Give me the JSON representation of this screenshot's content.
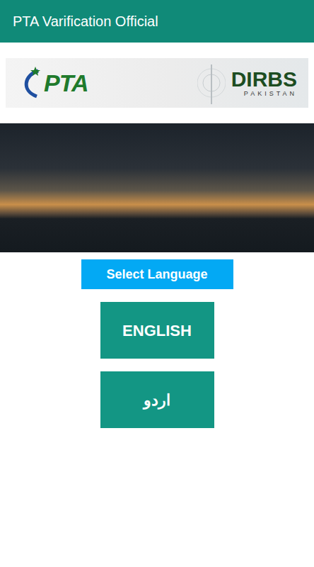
{
  "app_bar": {
    "title": "PTA Varification Official"
  },
  "banner": {
    "left_logo": "PTA",
    "right_logo": "DIRBS",
    "right_subtitle": "PAKISTAN"
  },
  "language_prompt": "Select Language",
  "languages": [
    {
      "label": "ENGLISH"
    },
    {
      "label": "اردو"
    }
  ]
}
